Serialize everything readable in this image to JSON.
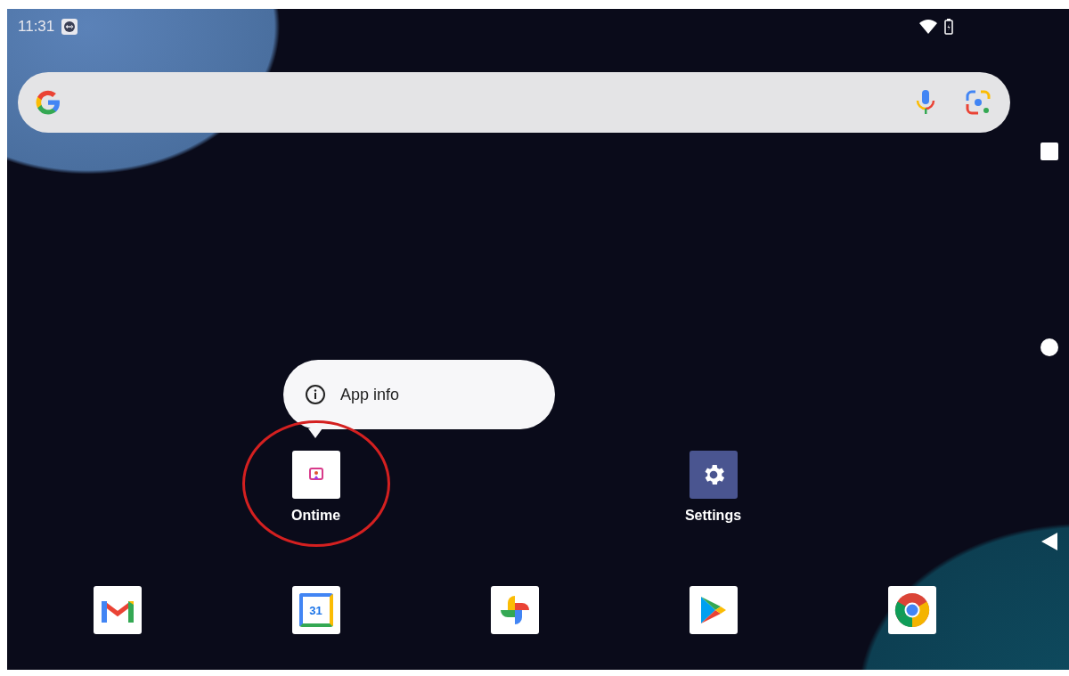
{
  "status_bar": {
    "time": "11:31"
  },
  "search_bar": {
    "kind": "google"
  },
  "popup_menu": {
    "items": [
      {
        "label": "App info",
        "kind": "info"
      }
    ]
  },
  "home_apps": [
    {
      "label": "Ontime",
      "kind": "ontime"
    },
    {
      "label": "Settings",
      "kind": "settings"
    }
  ],
  "dock": [
    {
      "kind": "gmail"
    },
    {
      "kind": "calendar",
      "text": "31"
    },
    {
      "kind": "photos"
    },
    {
      "kind": "play"
    },
    {
      "kind": "chrome"
    }
  ]
}
